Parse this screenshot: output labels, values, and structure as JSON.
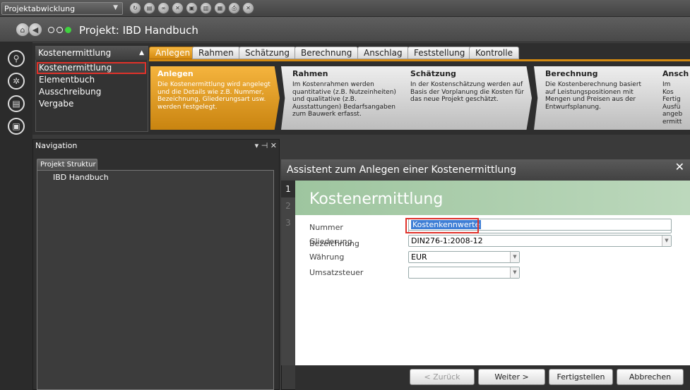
{
  "topbar": {
    "project_select": "Projektabwicklung"
  },
  "title": {
    "project": "Projekt: IBD Handbuch"
  },
  "module": {
    "selected": "Kostenermittlung",
    "items": [
      "Kostenermittlung",
      "Elementbuch",
      "Ausschreibung",
      "Vergabe"
    ]
  },
  "tabs": [
    "Anlegen",
    "Rahmen",
    "Schätzung",
    "Berechnung",
    "Anschlag",
    "Feststellung",
    "Kontrolle"
  ],
  "cards": [
    {
      "title": "Anlegen",
      "desc": "Die Kostenermittlung wird angelegt und die Details wie z.B. Nummer, Bezeichnung, Gliederungsart usw. werden festgelegt."
    },
    {
      "title": "Rahmen",
      "desc": "Im Kostenrahmen werden quantitative (z.B. Nutzeinheiten) und qualitative (z.B. Ausstattungen) Bedarfsangaben zum Bauwerk erfasst."
    },
    {
      "title": "Schätzung",
      "desc": "In der Kostenschätzung werden auf Basis der Vorplanung die Kosten für das neue Projekt geschätzt."
    },
    {
      "title": "Berechnung",
      "desc": "Die Kostenberechnung basiert auf Leistungspositionen mit Mengen und Preisen aus der Entwurfsplanung."
    },
    {
      "title": "Ansch",
      "desc": "Im Kos Fertig Ausfü angeb ermitt"
    }
  ],
  "navigation": {
    "title": "Navigation",
    "pin": "▾ ⊣ ✕",
    "tab": "Projekt Struktur",
    "tree_root": "IBD Handbuch"
  },
  "wizard": {
    "title": "Assistent zum Anlegen einer Kostenermittlung",
    "heading": "Kostenermittlung",
    "steps": [
      "1",
      "2",
      "3"
    ],
    "fields": {
      "nummer_label": "Nummer",
      "nummer_value": "",
      "bezeichnung_label": "Bezeichnung",
      "bezeichnung_value": "Kostenkennwerte",
      "gliederung_label": "Gliederung",
      "gliederung_value": "DIN276-1:2008-12",
      "waehrung_label": "Währung",
      "waehrung_value": "EUR",
      "umsatzsteuer_label": "Umsatzsteuer",
      "umsatzsteuer_value": ""
    },
    "buttons": {
      "back": "< Zurück",
      "next": "Weiter >",
      "finish": "Fertigstellen",
      "cancel": "Abbrechen"
    }
  }
}
